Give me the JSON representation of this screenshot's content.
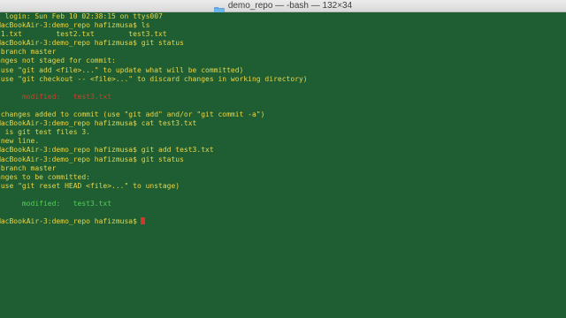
{
  "window": {
    "title": "demo_repo — -bash — 132×34",
    "title_icon": "folder-icon",
    "background_color": "#1f5e32"
  },
  "terminal": {
    "lines": [
      {
        "text": "t login: Sun Feb 10 02:38:15 on ttys007",
        "color": "default"
      },
      {
        "text": "MacBookAir-3:demo_repo hafizmusa$ ls",
        "color": "default"
      },
      {
        "text": "t1.txt        test2.txt        test3.txt",
        "color": "default"
      },
      {
        "text": "MacBookAir-3:demo_repo hafizmusa$ git status",
        "color": "default"
      },
      {
        "text": " branch master",
        "color": "default"
      },
      {
        "text": "anges not staged for commit:",
        "color": "default"
      },
      {
        "text": " use \"git add <file>...\" to update what will be committed)",
        "color": "default"
      },
      {
        "text": " use \"git checkout -- <file>...\" to discard changes in working directory)",
        "color": "default"
      },
      {
        "text": "",
        "color": "default"
      },
      {
        "text": "      modified:   test3.txt",
        "color": "red"
      },
      {
        "text": "",
        "color": "default"
      },
      {
        "text": " changes added to commit (use \"git add\" and/or \"git commit -a\")",
        "color": "default"
      },
      {
        "text": "MacBookAir-3:demo_repo hafizmusa$ cat test3.txt",
        "color": "default"
      },
      {
        "text": "s is git test files 3.",
        "color": "default"
      },
      {
        "text": " new line.",
        "color": "default"
      },
      {
        "text": "MacBookAir-3:demo_repo hafizmusa$ git add test3.txt",
        "color": "default"
      },
      {
        "text": "MacBookAir-3:demo_repo hafizmusa$ git status",
        "color": "default"
      },
      {
        "text": " branch master",
        "color": "default"
      },
      {
        "text": "anges to be committed:",
        "color": "default"
      },
      {
        "text": " use \"git reset HEAD <file>...\" to unstage)",
        "color": "default"
      },
      {
        "text": "",
        "color": "default"
      },
      {
        "text": "      modified:   test3.txt",
        "color": "green"
      },
      {
        "text": "",
        "color": "default"
      },
      {
        "text": "MacBookAir-3:demo_repo hafizmusa$",
        "color": "default",
        "cursor": true
      }
    ],
    "colors": {
      "default": "#e8d54a",
      "red": "#d83a2c",
      "green": "#4fd24f",
      "cursor": "#d3372b"
    }
  }
}
